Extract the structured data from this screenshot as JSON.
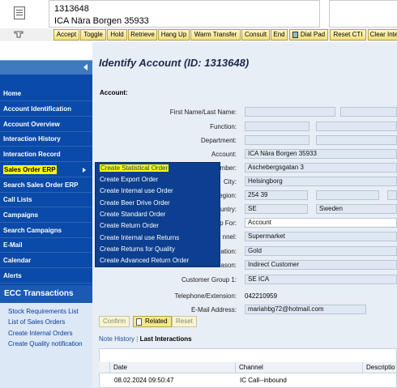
{
  "header": {
    "account_id": "1313648",
    "account_name": "ICA Nära Borgen 35933"
  },
  "toolbar": {
    "buttons": [
      "Accept",
      "Toggle",
      "Hold",
      "Retrieve",
      "Hang Up",
      "Warm Transfer",
      "Consult",
      "End",
      "Dial Pad",
      "Reset CTI",
      "Clear Inte"
    ]
  },
  "sidebar": {
    "items": [
      "Home",
      "Account Identification",
      "Account Overview",
      "Interaction History",
      "Interaction Record",
      "Sales Order ERP",
      "Search Sales Order ERP",
      "Call Lists",
      "Campaigns",
      "Search Campaigns",
      "E-Mail",
      "Calendar",
      "Alerts"
    ],
    "selected": "Sales Order ERP",
    "ecc_title": "ECC Transactions",
    "ecc_links": [
      "Stock Requirements List",
      "List of Sales Orders",
      "Create Internal Orders",
      "Create Quality notification"
    ]
  },
  "main": {
    "title": "Identify Account (ID: 1313648)",
    "section": "Account:",
    "labels": {
      "first_last": "First Name/Last Name:",
      "function": "Function:",
      "department": "Department:",
      "account": "Account:",
      "number": "umber:",
      "city": "City:",
      "region": "egion:",
      "country": "untry:",
      "for": "p For:",
      "channel": "nnel:",
      "classification": "ation:",
      "reason": "ason:",
      "customer_group": "Customer Group 1:",
      "telephone": "Telephone/Extension:",
      "email": "E-Mail Address:"
    },
    "values": {
      "account": "ICA Nära Borgen 35933",
      "street": "Aschebergsgatan 3",
      "city": "Helsingborg",
      "postal": "254 39",
      "country_code": "SE",
      "country_name": "Sweden",
      "for": "Account",
      "channel": "Supermarket",
      "classification": "Gold",
      "reason": "Indirect Customer",
      "customer_group": "SE ICA",
      "telephone": "042210959",
      "email": "mariahbg72@hotmail.com"
    },
    "buttons": {
      "confirm": "Confirm",
      "related": "Related",
      "reset": "Reset"
    },
    "tabs": {
      "note_history": "Note History",
      "last_interactions": "Last Interactions"
    },
    "table": {
      "headers": [
        "Date",
        "Channel",
        "Descriptio"
      ],
      "rows": [
        [
          "08.02.2024 09:50:47",
          "IC Call--inbound",
          ""
        ]
      ]
    }
  },
  "menu": {
    "items": [
      "Create Statistical Order",
      "Create Export Order",
      "Create Internal use Order",
      "Create Beer Drive Order",
      "Create Standard Order",
      "Create Return Order",
      "Create Internal use Returns",
      "Create Returns for Quality",
      "Create Advanced Return Order"
    ]
  },
  "colors": {
    "nav_bg": "#0a4aa8",
    "highlight": "#ffff00",
    "toolbar_btn": "#f2df7a"
  }
}
